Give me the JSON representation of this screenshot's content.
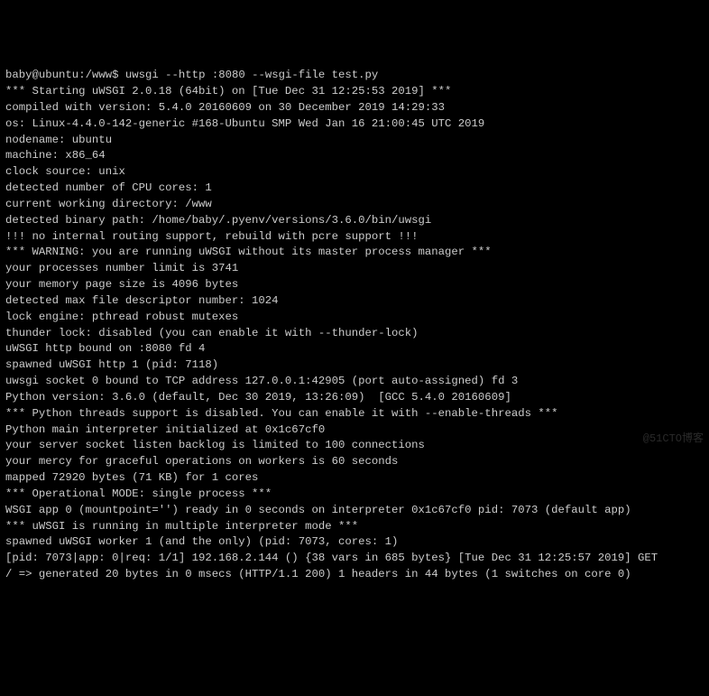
{
  "prompt": {
    "user_host": "baby@ubuntu",
    "path": "/www",
    "symbol": "$",
    "command": "uwsgi --http :8080 --wsgi-file test.py"
  },
  "lines": [
    "*** Starting uWSGI 2.0.18 (64bit) on [Tue Dec 31 12:25:53 2019] ***",
    "compiled with version: 5.4.0 20160609 on 30 December 2019 14:29:33",
    "os: Linux-4.4.0-142-generic #168-Ubuntu SMP Wed Jan 16 21:00:45 UTC 2019",
    "nodename: ubuntu",
    "machine: x86_64",
    "clock source: unix",
    "detected number of CPU cores: 1",
    "current working directory: /www",
    "detected binary path: /home/baby/.pyenv/versions/3.6.0/bin/uwsgi",
    "!!! no internal routing support, rebuild with pcre support !!!",
    "*** WARNING: you are running uWSGI without its master process manager ***",
    "your processes number limit is 3741",
    "your memory page size is 4096 bytes",
    "detected max file descriptor number: 1024",
    "lock engine: pthread robust mutexes",
    "thunder lock: disabled (you can enable it with --thunder-lock)",
    "uWSGI http bound on :8080 fd 4",
    "spawned uWSGI http 1 (pid: 7118)",
    "uwsgi socket 0 bound to TCP address 127.0.0.1:42905 (port auto-assigned) fd 3",
    "Python version: 3.6.0 (default, Dec 30 2019, 13:26:09)  [GCC 5.4.0 20160609]",
    "*** Python threads support is disabled. You can enable it with --enable-threads ***",
    "Python main interpreter initialized at 0x1c67cf0",
    "your server socket listen backlog is limited to 100 connections",
    "your mercy for graceful operations on workers is 60 seconds",
    "mapped 72920 bytes (71 KB) for 1 cores",
    "*** Operational MODE: single process ***",
    "WSGI app 0 (mountpoint='') ready in 0 seconds on interpreter 0x1c67cf0 pid: 7073 (default app)",
    "*** uWSGI is running in multiple interpreter mode ***",
    "spawned uWSGI worker 1 (and the only) (pid: 7073, cores: 1)",
    "[pid: 7073|app: 0|req: 1/1] 192.168.2.144 () {38 vars in 685 bytes} [Tue Dec 31 12:25:57 2019] GET",
    "/ => generated 20 bytes in 0 msecs (HTTP/1.1 200) 1 headers in 44 bytes (1 switches on core 0)"
  ],
  "watermark": "@51CTO博客"
}
